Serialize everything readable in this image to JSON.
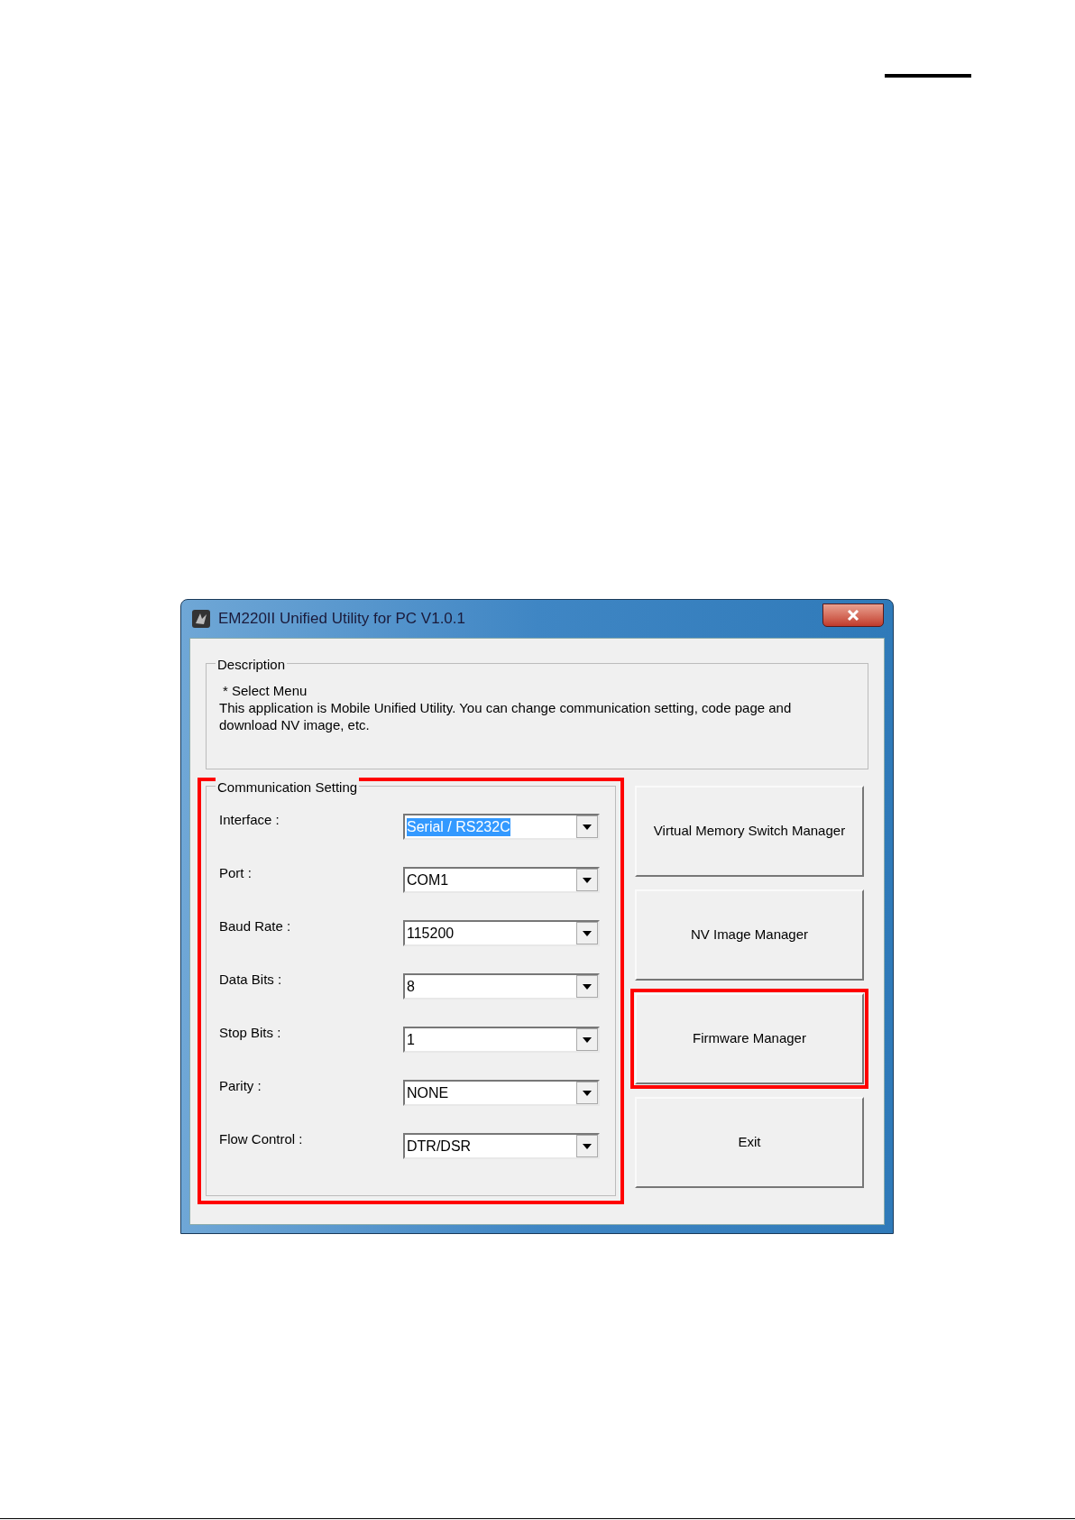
{
  "window": {
    "title": "EM220II Unified Utility for PC V1.0.1"
  },
  "description": {
    "legend": "Description",
    "lines": [
      "* Select Menu",
      "This application is Mobile Unified Utility. You can change communication setting, code page and download NV image, etc."
    ]
  },
  "communication_setting": {
    "legend": "Communication Setting",
    "highlighted": true,
    "fields": [
      {
        "label": "Interface :",
        "value": "Serial / RS232C",
        "text_selected": true
      },
      {
        "label": "Port :",
        "value": "COM1",
        "text_selected": false
      },
      {
        "label": "Baud Rate :",
        "value": "115200",
        "text_selected": false
      },
      {
        "label": "Data Bits :",
        "value": "8",
        "text_selected": false
      },
      {
        "label": "Stop Bits :",
        "value": "1",
        "text_selected": false
      },
      {
        "label": "Parity :",
        "value": "NONE",
        "text_selected": false
      },
      {
        "label": "Flow Control :",
        "value": "DTR/DSR",
        "text_selected": false
      }
    ]
  },
  "buttons": [
    {
      "label": "Virtual Memory Switch Manager",
      "highlighted": false
    },
    {
      "label": "NV Image Manager",
      "highlighted": false
    },
    {
      "label": "Firmware Manager",
      "highlighted": true
    },
    {
      "label": "Exit",
      "highlighted": false
    }
  ]
}
